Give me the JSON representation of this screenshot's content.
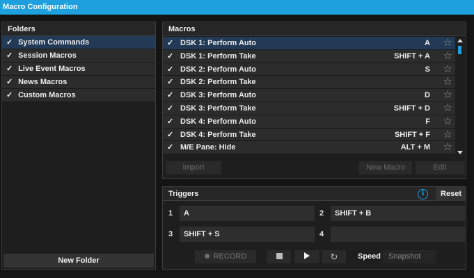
{
  "window": {
    "title": "Macro Configuration"
  },
  "folders": {
    "header": "Folders",
    "items": [
      {
        "label": "System Commands",
        "checked": true,
        "selected": true
      },
      {
        "label": "Session Macros",
        "checked": true,
        "selected": false
      },
      {
        "label": "Live Event Macros",
        "checked": true,
        "selected": false
      },
      {
        "label": "News Macros",
        "checked": true,
        "selected": false
      },
      {
        "label": "Custom Macros",
        "checked": true,
        "selected": false
      }
    ],
    "new_folder_label": "New Folder"
  },
  "macros": {
    "header": "Macros",
    "rows": [
      {
        "name": "DSK 1: Perform Auto",
        "shortcut": "A",
        "selected": true
      },
      {
        "name": "DSK 1: Perform Take",
        "shortcut": "SHIFT + A",
        "selected": false
      },
      {
        "name": "DSK 2: Perform Auto",
        "shortcut": "S",
        "selected": false
      },
      {
        "name": "DSK 2: Perform Take",
        "shortcut": "",
        "selected": false
      },
      {
        "name": "DSK 3: Perform Auto",
        "shortcut": "D",
        "selected": false
      },
      {
        "name": "DSK 3: Perform Take",
        "shortcut": "SHIFT + D",
        "selected": false
      },
      {
        "name": "DSK 4: Perform Auto",
        "shortcut": "F",
        "selected": false
      },
      {
        "name": "DSK 4: Perform Take",
        "shortcut": "SHIFT + F",
        "selected": false
      },
      {
        "name": "M/E Pane: Hide",
        "shortcut": "ALT + M",
        "selected": false
      }
    ],
    "check_glyph": "✓",
    "star_glyph": "☆",
    "import_label": "Import",
    "new_macro_label": "New Macro",
    "edit_label": "Edit"
  },
  "triggers": {
    "header": "Triggers",
    "info_glyph": "i",
    "reset_label": "Reset",
    "slots": [
      {
        "num": "1",
        "value": "A"
      },
      {
        "num": "2",
        "value": "SHIFT + B"
      },
      {
        "num": "3",
        "value": "SHIFT + S"
      },
      {
        "num": "4",
        "value": ""
      }
    ],
    "record_label": "RECORD",
    "loop_glyph": "↻",
    "speed_label": "Speed",
    "snapshot_label": "Snapshot"
  },
  "colors": {
    "accent": "#1ea0de",
    "selected_row": "#223a55",
    "panel_bg": "#1e1e1e",
    "row_bg": "#2c2c2c"
  }
}
